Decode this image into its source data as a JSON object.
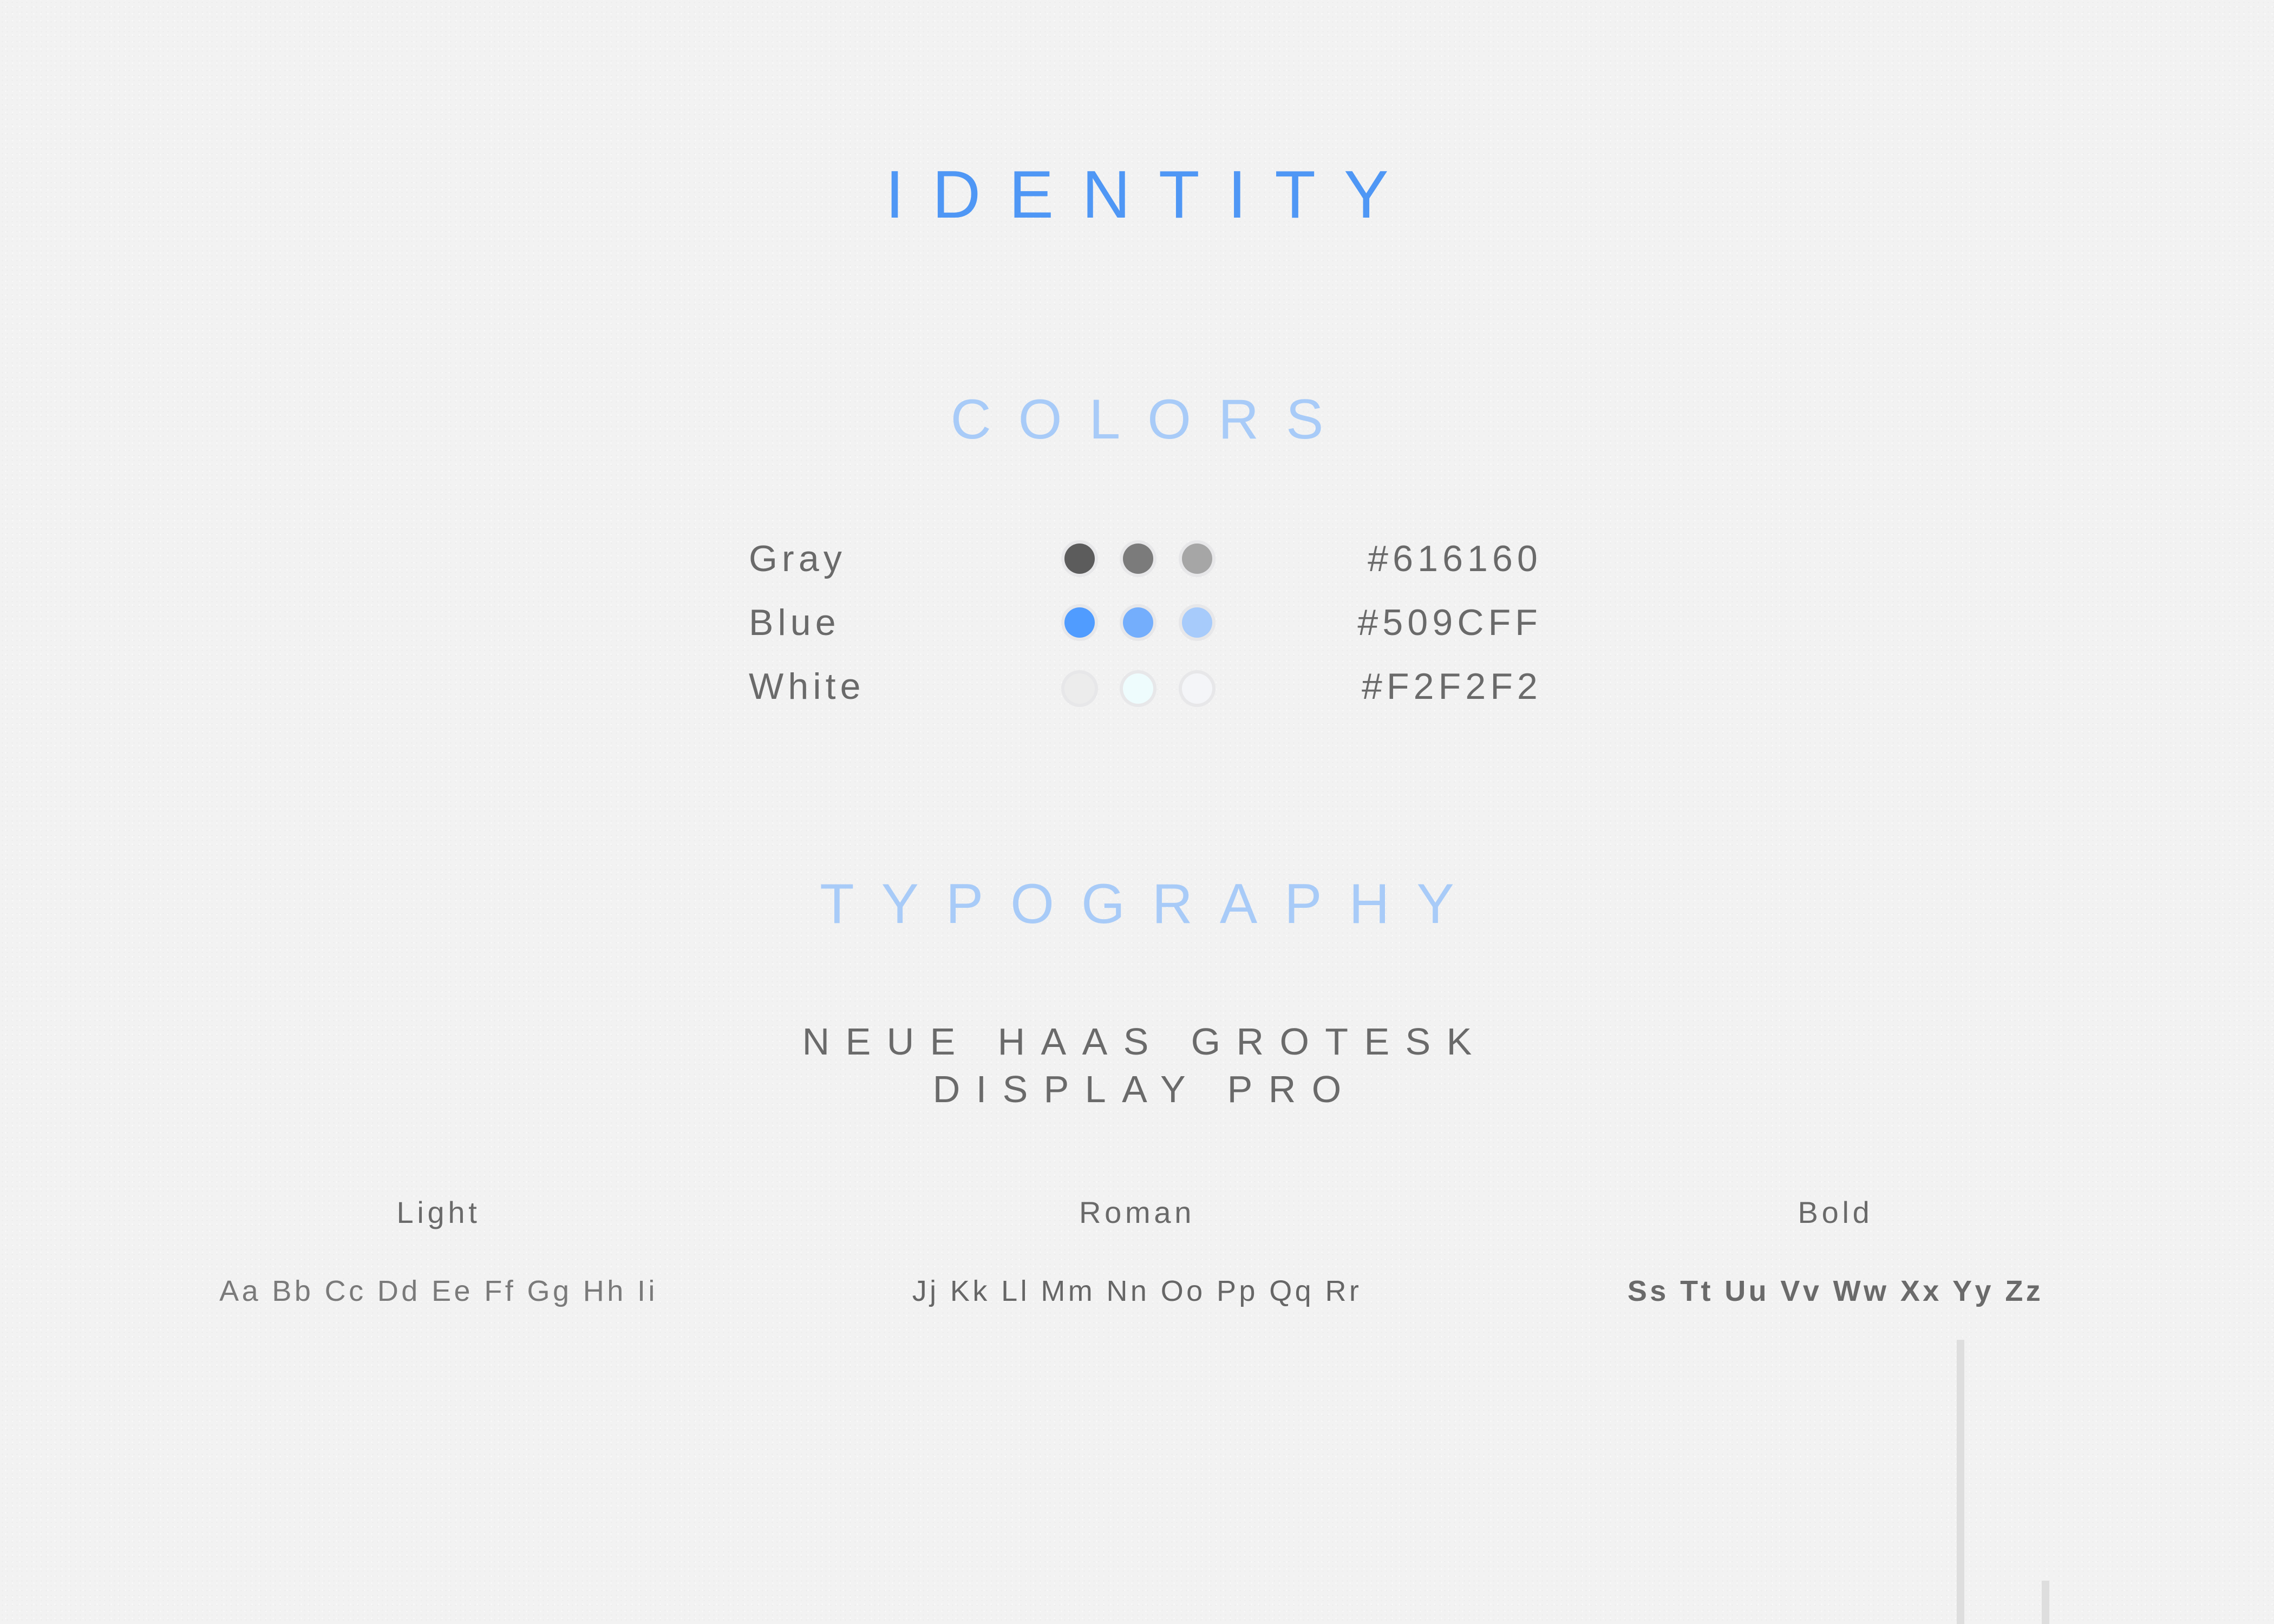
{
  "title": "IDENTITY",
  "colors_section": {
    "title": "COLORS",
    "rows": [
      {
        "name": "Gray",
        "hex": "#616160",
        "swatches": [
          "#5c5c5c",
          "#7b7b7b",
          "#a6a6a6"
        ]
      },
      {
        "name": "Blue",
        "hex": "#509CFF",
        "swatches": [
          "#509cff",
          "#74aefc",
          "#a7cbfb"
        ]
      },
      {
        "name": "White",
        "hex": "#F2F2F2",
        "swatches": [
          "#ececec",
          "#eefcfd",
          "#f4f5f8"
        ]
      }
    ]
  },
  "typography_section": {
    "title": "TYPOGRAPHY",
    "font_name_line1": "NEUE HAAS GROTESK",
    "font_name_line2": "DISPLAY PRO",
    "weights": [
      {
        "label": "Light",
        "sample": "Aa Bb Cc Dd Ee Ff Gg Hh Ii"
      },
      {
        "label": "Roman",
        "sample": "Jj Kk Ll Mm Nn Oo Pp Qq Rr"
      },
      {
        "label": "Bold",
        "sample": "Ss Tt Uu Vv Ww Xx Yy Zz"
      }
    ]
  },
  "colors": {
    "title_blue": "#4f97f5",
    "section_title_blue": "#a8cbf8",
    "text_gray": "#6a6a6a"
  }
}
